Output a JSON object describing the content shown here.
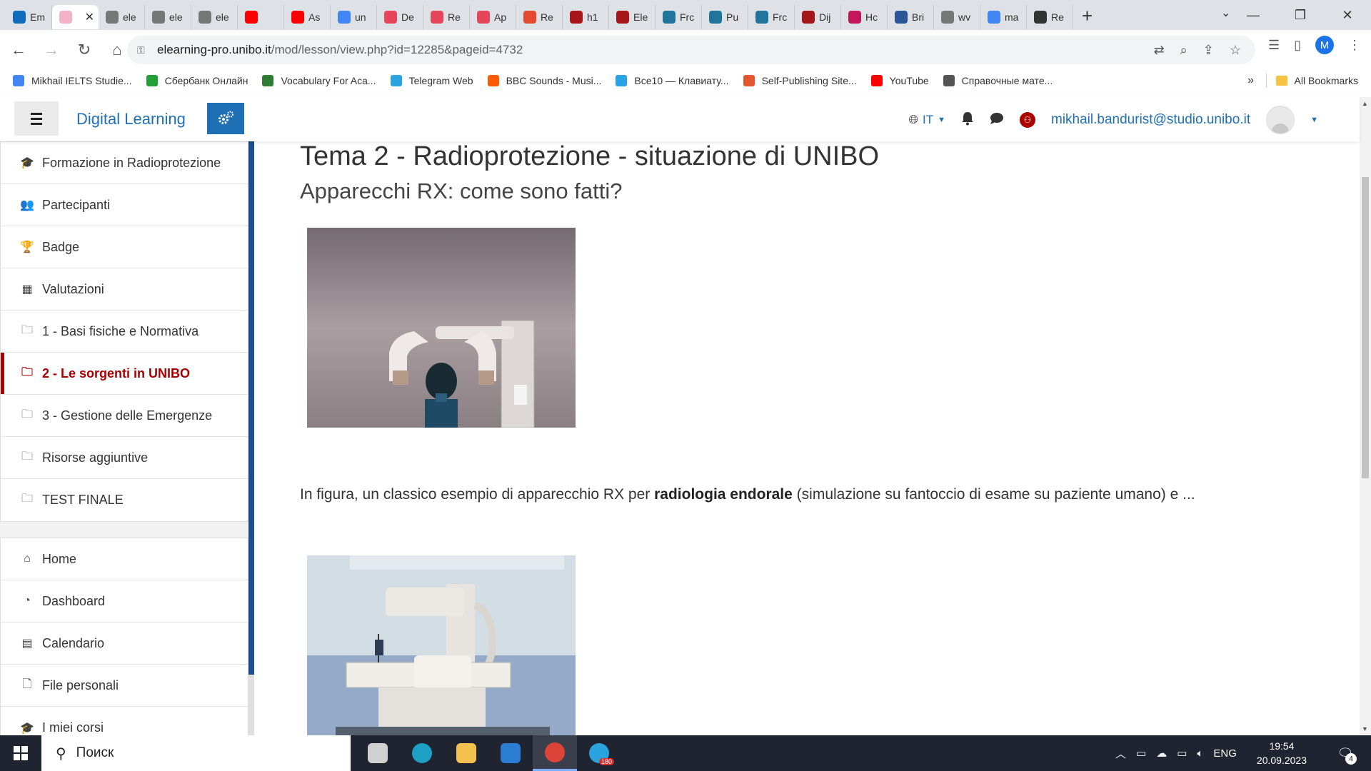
{
  "browser": {
    "tabs": [
      {
        "title": "Em",
        "icon": "outlook-icon",
        "color": "#0f6cbd"
      },
      {
        "title": "",
        "icon": "flower-icon",
        "color": "#f3b3c7",
        "active": true
      },
      {
        "title": "ele",
        "icon": "globe-icon",
        "color": "#777777"
      },
      {
        "title": "ele",
        "icon": "globe-icon",
        "color": "#777777"
      },
      {
        "title": "ele",
        "icon": "globe-icon",
        "color": "#777777"
      },
      {
        "title": "",
        "icon": "youtube-icon",
        "color": "#ff0000"
      },
      {
        "title": "As",
        "icon": "youtube-icon",
        "color": "#ff0000"
      },
      {
        "title": "un",
        "icon": "google-icon",
        "color": "#4285f4"
      },
      {
        "title": "De",
        "icon": "app-icon",
        "color": "#e6455a"
      },
      {
        "title": "Re",
        "icon": "app-icon",
        "color": "#e6455a"
      },
      {
        "title": "Ap",
        "icon": "app-icon",
        "color": "#e6455a"
      },
      {
        "title": "Re",
        "icon": "hashtag-icon",
        "color": "#e34a2f"
      },
      {
        "title": "h1",
        "icon": "shield-icon",
        "color": "#a4161a"
      },
      {
        "title": "Ele",
        "icon": "shield-icon",
        "color": "#a4161a"
      },
      {
        "title": "Frc",
        "icon": "wordpress-icon",
        "color": "#21759b"
      },
      {
        "title": "Pu",
        "icon": "wordpress-icon",
        "color": "#21759b"
      },
      {
        "title": "Frc",
        "icon": "wordpress-icon",
        "color": "#21759b"
      },
      {
        "title": "Dij",
        "icon": "shield-icon",
        "color": "#a4161a"
      },
      {
        "title": "Hc",
        "icon": "hashtag-icon",
        "color": "#c2185b"
      },
      {
        "title": "Bri",
        "icon": "app-icon",
        "color": "#2b5797"
      },
      {
        "title": "wv",
        "icon": "globe-icon",
        "color": "#777777"
      },
      {
        "title": "ma",
        "icon": "google-icon",
        "color": "#4285f4"
      },
      {
        "title": "Re",
        "icon": "r6-icon",
        "color": "#333333"
      }
    ],
    "url_host": "elearning-pro.unibo.it",
    "url_path": "/mod/lesson/view.php?id=12285&pageid=4732",
    "profile_initial": "M",
    "bookmarks": [
      {
        "label": "Mikhail IELTS Studie...",
        "icon": "docs-icon",
        "color": "#4285f4"
      },
      {
        "label": "Сбербанк Онлайн",
        "icon": "sber-icon",
        "color": "#21a038"
      },
      {
        "label": "Vocabulary For Aca...",
        "icon": "ielts-icon",
        "color": "#2e7d32"
      },
      {
        "label": "Telegram Web",
        "icon": "telegram-icon",
        "color": "#2aa3df"
      },
      {
        "label": "BBC Sounds - Musi...",
        "icon": "bbc-icon",
        "color": "#ff5a00"
      },
      {
        "label": "Все10 — Клавиату...",
        "icon": "keyboard-icon",
        "color": "#29a3e6"
      },
      {
        "label": "Self-Publishing Site...",
        "icon": "p-icon",
        "color": "#e4572e"
      },
      {
        "label": "YouTube",
        "icon": "youtube-icon",
        "color": "#ff0000"
      },
      {
        "label": "Справочные мате...",
        "icon": "globe-icon",
        "color": "#555555"
      }
    ],
    "all_bookmarks": "All Bookmarks"
  },
  "moodle": {
    "site_name": "Digital Learning",
    "lang": "IT",
    "user_email": "mikhail.bandurist@studio.unibo.it",
    "drawer_course": [
      {
        "label": "Formazione in Radioprotezione",
        "icon": "graduation-cap-icon",
        "glyph": "🎓"
      },
      {
        "label": "Partecipanti",
        "icon": "users-icon",
        "glyph": "👥"
      },
      {
        "label": "Badge",
        "icon": "trophy-icon",
        "glyph": "🏆"
      },
      {
        "label": "Valutazioni",
        "icon": "table-icon",
        "glyph": "▦"
      },
      {
        "label": "1 - Basi fisiche e Normativa",
        "icon": "folder-icon",
        "glyph": "🗀"
      },
      {
        "label": "2 - Le sorgenti in UNIBO",
        "icon": "folder-icon",
        "glyph": "🗀",
        "active": true
      },
      {
        "label": "3 - Gestione delle Emergenze",
        "icon": "folder-icon",
        "glyph": "🗀"
      },
      {
        "label": "Risorse aggiuntive",
        "icon": "folder-icon",
        "glyph": "🗀"
      },
      {
        "label": "TEST FINALE",
        "icon": "folder-icon",
        "glyph": "🗀"
      }
    ],
    "drawer_site": [
      {
        "label": "Home",
        "icon": "home-icon",
        "glyph": "⌂"
      },
      {
        "label": "Dashboard",
        "icon": "dashboard-icon",
        "glyph": "◔"
      },
      {
        "label": "Calendario",
        "icon": "calendar-icon",
        "glyph": "▤"
      },
      {
        "label": "File personali",
        "icon": "file-icon",
        "glyph": "🗋"
      },
      {
        "label": "I miei corsi",
        "icon": "graduation-cap-icon",
        "glyph": "🎓"
      }
    ],
    "lesson_title": "Tema 2 - Radioprotezione - situazione di UNIBO",
    "page_heading": "Apparecchi RX: come sono fatti?",
    "paragraph": {
      "before": "In figura, un classico esempio di apparecchio RX per ",
      "bold": "radiologia endorale",
      "after": " (simulazione su fantoccio di esame su paziente umano) e ..."
    }
  },
  "taskbar": {
    "search_placeholder": "Поиск",
    "apps": [
      {
        "icon": "task-view-icon",
        "color": "#d0d0d0"
      },
      {
        "icon": "edge-icon",
        "color": "#1da1c4"
      },
      {
        "icon": "file-explorer-icon",
        "color": "#f2c14e"
      },
      {
        "icon": "mail-icon",
        "color": "#2b7cd3"
      },
      {
        "icon": "chrome-icon",
        "color": "#db4437",
        "active": true
      },
      {
        "icon": "telegram-icon",
        "color": "#2aa3df",
        "badge": "180"
      }
    ],
    "language": "ENG",
    "time": "19:54",
    "date": "20.09.2023",
    "notification_count": "4"
  }
}
